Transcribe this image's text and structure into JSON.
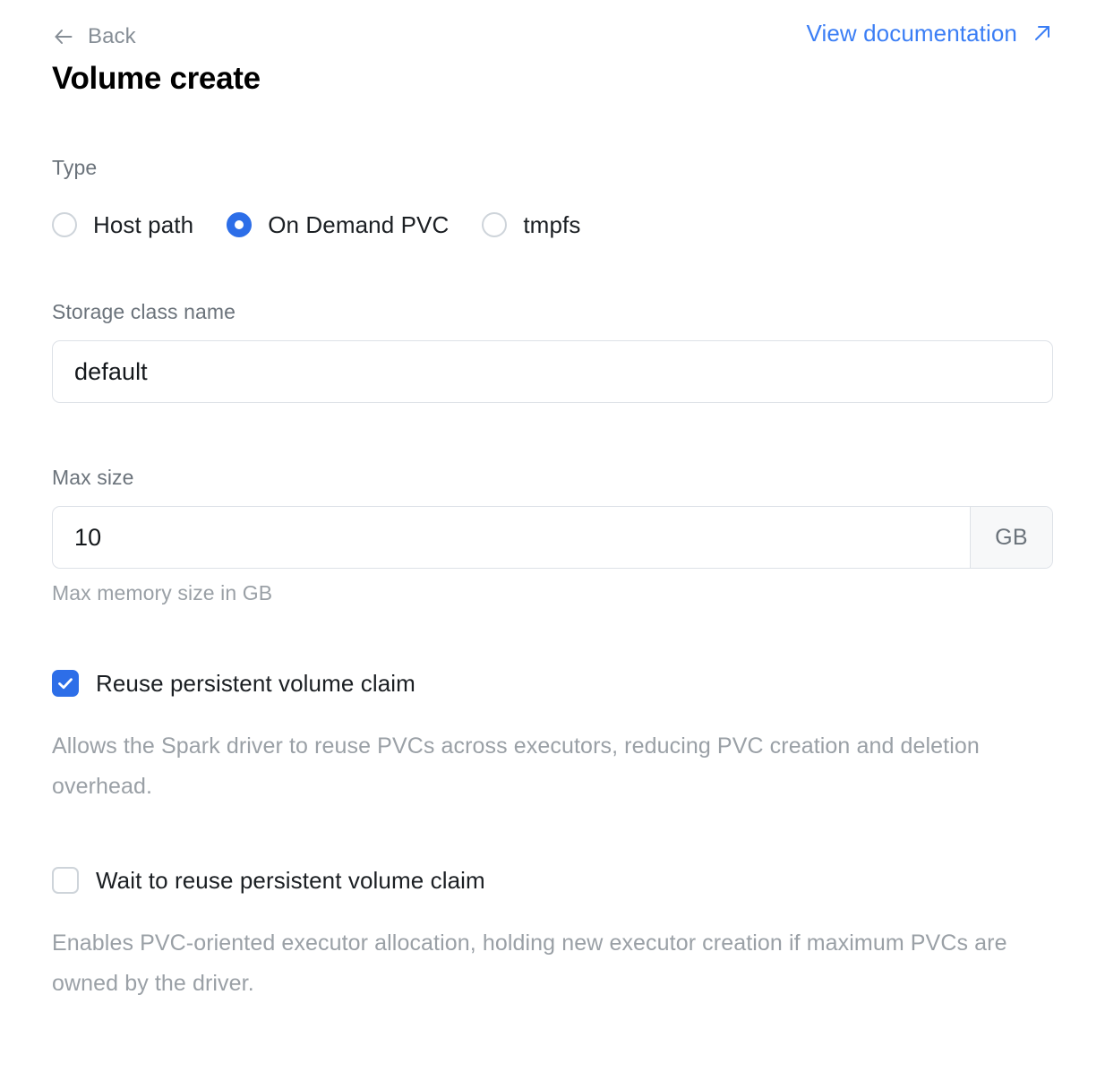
{
  "header": {
    "back_label": "Back",
    "back_icon": "arrow-left-icon",
    "doc_link_label": "View documentation",
    "doc_link_icon": "arrow-up-right-icon",
    "doc_link_color": "#3b7ef5",
    "title": "Volume create"
  },
  "type_field": {
    "label": "Type",
    "selected": "On Demand PVC",
    "options": [
      {
        "label": "Host path",
        "checked": false
      },
      {
        "label": "On Demand PVC",
        "checked": true
      },
      {
        "label": "tmpfs",
        "checked": false
      }
    ]
  },
  "storage_class": {
    "label": "Storage class name",
    "value": "default",
    "placeholder": "default"
  },
  "max_size": {
    "label": "Max size",
    "value": "10",
    "placeholder": "10",
    "unit": "GB",
    "help": "Max memory size in GB"
  },
  "reuse_pvc": {
    "label": "Reuse persistent volume claim",
    "checked": true,
    "description": "Allows the Spark driver to reuse PVCs across executors, reducing PVC creation and deletion overhead."
  },
  "wait_reuse_pvc": {
    "label": "Wait to reuse persistent volume claim",
    "checked": false,
    "description": "Enables PVC-oriented executor allocation, holding new executor creation if maximum PVCs are owned by the driver."
  },
  "theme": {
    "accent": "#2d6ee8",
    "link": "#3b7ef5",
    "muted_text": "#9aa0a6",
    "label_text": "#6b737b",
    "border": "#dde1e7"
  }
}
